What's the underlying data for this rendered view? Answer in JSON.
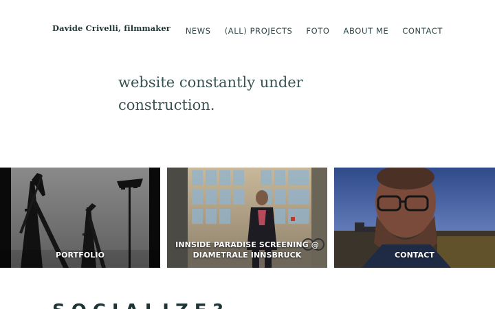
{
  "header": {
    "site_title": "Davide Crivelli, filmmaker",
    "nav": [
      {
        "label": "NEWS"
      },
      {
        "label": "(ALL) PROJECTS"
      },
      {
        "label": "FOTO"
      },
      {
        "label": "ABOUT ME"
      },
      {
        "label": "CONTACT"
      }
    ]
  },
  "intro": {
    "line1": "website constantly under",
    "line2": "construction."
  },
  "tiles": [
    {
      "label": "PORTFOLIO",
      "image": "cranes-silhouette-photo"
    },
    {
      "label": "INNSIDE PARADISE SCREENING @ DIAMETRALE INNSBRUCK",
      "image": "man-in-front-of-glass-building-photo"
    },
    {
      "label": "CONTACT",
      "image": "bearded-man-portrait-photo"
    }
  ],
  "section": {
    "heading": "SOCIALIZE?"
  },
  "colors": {
    "text_dark": "#1f3535",
    "text": "#3a5151",
    "background": "#ffffff"
  }
}
